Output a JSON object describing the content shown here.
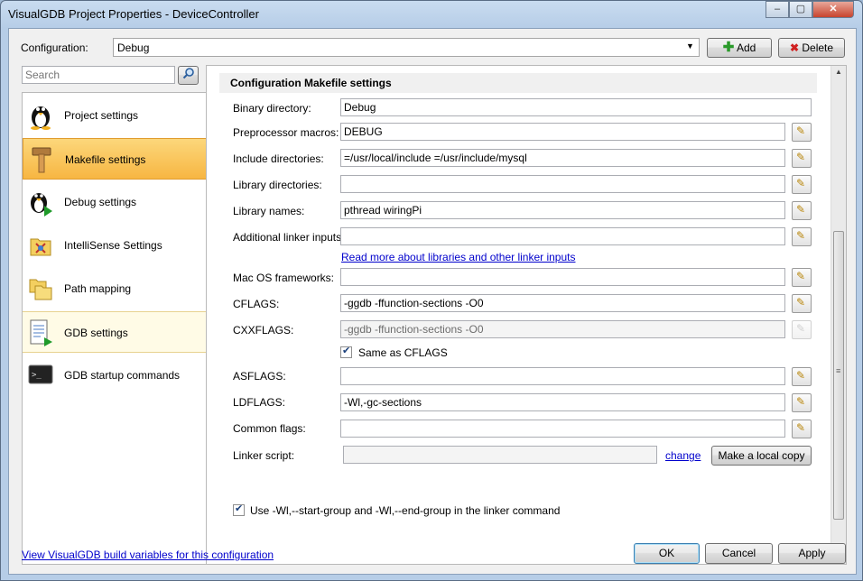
{
  "window": {
    "title": "VisualGDB Project Properties - DeviceController",
    "controls": {
      "minimize": "–",
      "restore": "▢",
      "close": "✕"
    }
  },
  "config": {
    "label": "Configuration:",
    "value": "Debug",
    "add_label": "Add",
    "delete_label": "Delete"
  },
  "search": {
    "placeholder": "Search"
  },
  "sidebar": {
    "items": [
      {
        "label": "Project settings",
        "icon": "penguin-icon"
      },
      {
        "label": "Makefile settings",
        "icon": "hammer-icon"
      },
      {
        "label": "Debug settings",
        "icon": "penguin-debug-icon"
      },
      {
        "label": "IntelliSense Settings",
        "icon": "intellisense-folder-icon"
      },
      {
        "label": "Path mapping",
        "icon": "folders-icon"
      },
      {
        "label": "GDB settings",
        "icon": "document-arrow-icon"
      },
      {
        "label": "GDB startup commands",
        "icon": "terminal-icon"
      }
    ]
  },
  "section": {
    "title": "Configuration Makefile settings"
  },
  "fields": {
    "binary_dir": {
      "label": "Binary directory:",
      "value": "Debug"
    },
    "preproc": {
      "label": "Preprocessor macros:",
      "value": "DEBUG"
    },
    "include_dirs": {
      "label": "Include directories:",
      "value": "=/usr/local/include =/usr/include/mysql"
    },
    "library_dirs": {
      "label": "Library directories:",
      "value": ""
    },
    "library_names": {
      "label": "Library names:",
      "value": "pthread wiringPi"
    },
    "linker_inputs": {
      "label": "Additional linker inputs:",
      "value": ""
    },
    "linker_link": "Read more about libraries and other linker inputs",
    "macos_fw": {
      "label": "Mac OS frameworks:",
      "value": ""
    },
    "cflags": {
      "label": "CFLAGS:",
      "value": "-ggdb -ffunction-sections -O0"
    },
    "cxxflags": {
      "label": "CXXFLAGS:",
      "value": "-ggdb -ffunction-sections -O0"
    },
    "same_as_cflags": {
      "label": "Same as CFLAGS",
      "checked": true
    },
    "asflags": {
      "label": "ASFLAGS:",
      "value": ""
    },
    "ldflags": {
      "label": "LDFLAGS:",
      "value": "-Wl,-gc-sections"
    },
    "common_flags": {
      "label": "Common flags:",
      "value": ""
    },
    "linker_script": {
      "label": "Linker script:",
      "value": "",
      "change": "change",
      "copy_button": "Make a local copy"
    },
    "start_group": {
      "label": "Use -Wl,--start-group and -Wl,--end-group in the linker command",
      "checked": true
    }
  },
  "footer": {
    "link": "View VisualGDB build variables for this configuration",
    "ok": "OK",
    "cancel": "Cancel",
    "apply": "Apply"
  }
}
